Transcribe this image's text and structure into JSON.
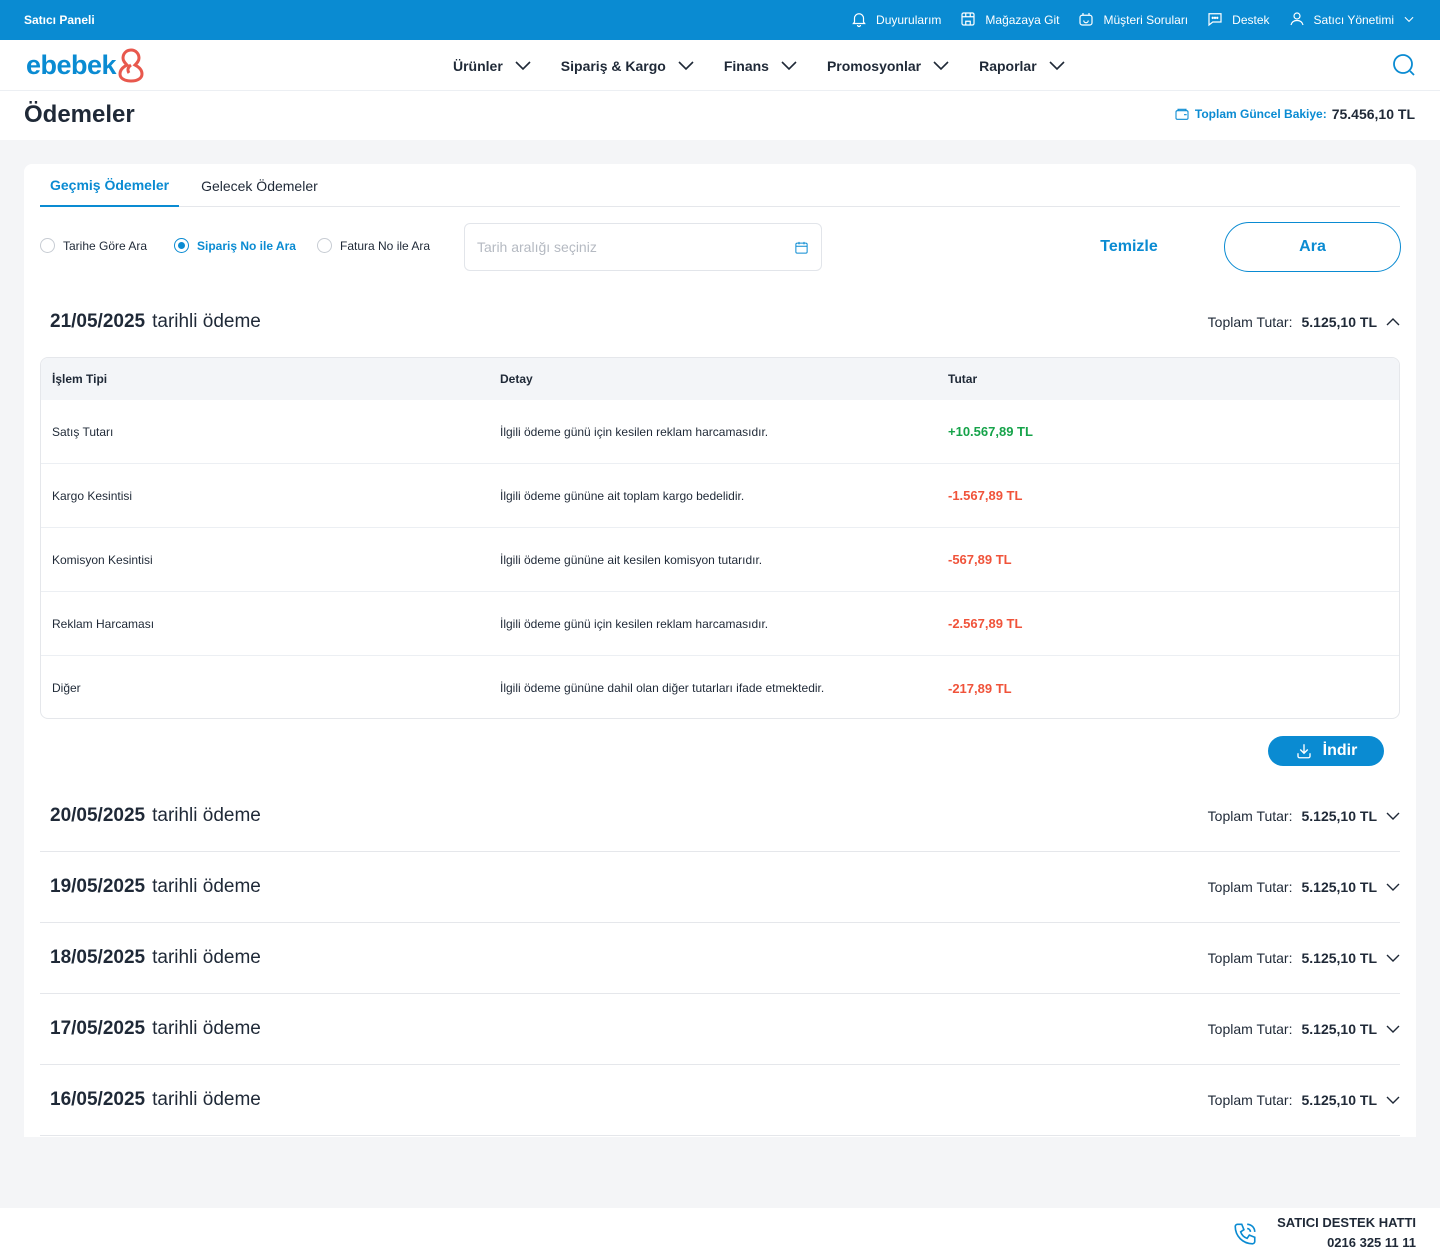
{
  "topbar": {
    "brand": "Satıcı Paneli",
    "links": [
      {
        "label": "Duyurularım",
        "icon": "bell-icon"
      },
      {
        "label": "Mağazaya Git",
        "icon": "store-icon"
      },
      {
        "label": "Müşteri Soruları",
        "icon": "customer-questions-icon"
      },
      {
        "label": "Destek",
        "icon": "chat-support-icon"
      },
      {
        "label": "Satıcı Yönetimi",
        "icon": "user-icon"
      }
    ],
    "color": "#0a8bd2"
  },
  "logo": {
    "text": "ebebek"
  },
  "nav": {
    "items": [
      "Ürünler",
      "Sipariş & Kargo",
      "Finans",
      "Promosyonlar",
      "Raporlar"
    ]
  },
  "page": {
    "title": "Ödemeler",
    "balance_label": "Toplam Güncel Bakiye:",
    "balance_value": "75.456,10 TL"
  },
  "tabs": [
    "Geçmiş Ödemeler",
    "Gelecek Ödemeler"
  ],
  "active_tab": 0,
  "filters": {
    "options": [
      "Tarihe Göre Ara",
      "Sipariş No ile Ara",
      "Fatura No ile Ara"
    ],
    "selected": 1,
    "date_placeholder": "Tarih aralığı seçiniz",
    "clear_label": "Temizle",
    "search_label": "Ara"
  },
  "payments": [
    {
      "date": "21/05/2025",
      "suffix": "tarihli ödeme",
      "total_label": "Toplam Tutar:",
      "total": "5.125,10 TL",
      "expanded": true
    },
    {
      "date": "20/05/2025",
      "suffix": "tarihli ödeme",
      "total_label": "Toplam Tutar:",
      "total": "5.125,10 TL",
      "expanded": false
    },
    {
      "date": "19/05/2025",
      "suffix": "tarihli ödeme",
      "total_label": "Toplam Tutar:",
      "total": "5.125,10 TL",
      "expanded": false
    },
    {
      "date": "18/05/2025",
      "suffix": "tarihli ödeme",
      "total_label": "Toplam Tutar:",
      "total": "5.125,10 TL",
      "expanded": false
    },
    {
      "date": "17/05/2025",
      "suffix": "tarihli ödeme",
      "total_label": "Toplam Tutar:",
      "total": "5.125,10 TL",
      "expanded": false
    },
    {
      "date": "16/05/2025",
      "suffix": "tarihli ödeme",
      "total_label": "Toplam Tutar:",
      "total": "5.125,10 TL",
      "expanded": false
    }
  ],
  "table": {
    "headers": [
      "İşlem Tipi",
      "Detay",
      "Tutar"
    ],
    "rows": [
      {
        "type": "Satış Tutarı",
        "detail": "İlgili ödeme günü için kesilen reklam harcamasıdır.",
        "amount": "+10.567,89 TL",
        "sign": "positive"
      },
      {
        "type": "Kargo Kesintisi",
        "detail": "İlgili ödeme gününe ait toplam kargo bedelidir.",
        "amount": "-1.567,89 TL",
        "sign": "negative"
      },
      {
        "type": "Komisyon Kesintisi",
        "detail": "İlgili ödeme gününe ait kesilen komisyon tutarıdır.",
        "amount": "-567,89 TL",
        "sign": "negative"
      },
      {
        "type": "Reklam Harcaması",
        "detail": "İlgili ödeme günü için kesilen reklam harcamasıdır.",
        "amount": "-2.567,89 TL",
        "sign": "negative"
      },
      {
        "type": "Diğer",
        "detail": "İlgili ödeme gününe dahil olan diğer tutarları ifade etmektedir.",
        "amount": "-217,89 TL",
        "sign": "negative"
      }
    ]
  },
  "download_label": "İndir",
  "footer": {
    "support_title": "SATICI DESTEK HATTI",
    "support_phone": "0216 325 11 11"
  },
  "colors": {
    "accent": "#0a8bd2",
    "positive": "#16a34a",
    "negative": "#f0533a",
    "logo_icon": "#e8584d"
  }
}
